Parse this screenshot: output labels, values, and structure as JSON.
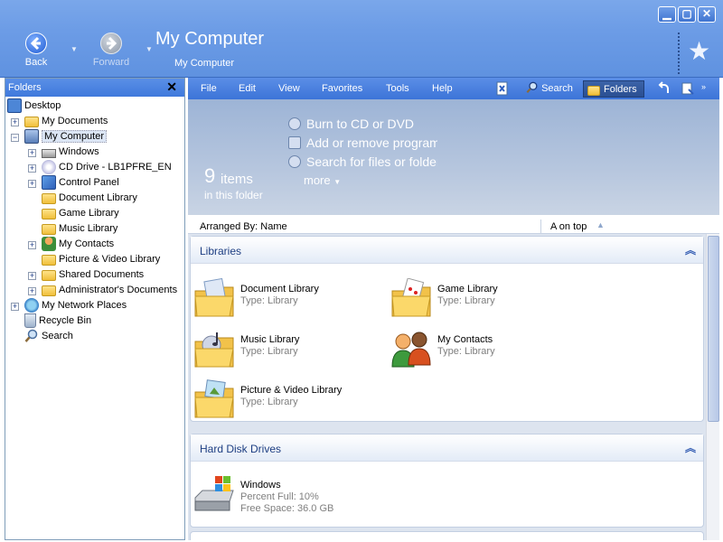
{
  "header": {
    "back_label": "Back",
    "forward_label": "Forward",
    "title": "My Computer",
    "address": "My Computer"
  },
  "folders_pane": {
    "title": "Folders",
    "items": [
      {
        "label": "Desktop",
        "icon": "desktop-icon"
      },
      {
        "label": "My Documents",
        "icon": "my-documents-icon"
      },
      {
        "label": "My Computer",
        "icon": "my-computer-icon",
        "selected": true
      },
      {
        "label": "Windows",
        "icon": "drive-icon"
      },
      {
        "label": "CD Drive - LB1PFRE_EN",
        "icon": "cd-drive-icon"
      },
      {
        "label": "Control Panel",
        "icon": "control-panel-icon"
      },
      {
        "label": "Document Library",
        "icon": "library-icon"
      },
      {
        "label": "Game Library",
        "icon": "library-icon"
      },
      {
        "label": "Music Library",
        "icon": "library-icon"
      },
      {
        "label": "My Contacts",
        "icon": "contacts-icon"
      },
      {
        "label": "Picture & Video Library",
        "icon": "library-icon"
      },
      {
        "label": "Shared Documents",
        "icon": "folder-icon"
      },
      {
        "label": "Administrator's Documents",
        "icon": "folder-icon"
      },
      {
        "label": "My Network Places",
        "icon": "network-icon"
      },
      {
        "label": "Recycle Bin",
        "icon": "recycle-bin-icon"
      },
      {
        "label": "Search",
        "icon": "search-icon"
      }
    ]
  },
  "menu": {
    "file": "File",
    "edit": "Edit",
    "view": "View",
    "favorites": "Favorites",
    "tools": "Tools",
    "help": "Help",
    "search": "Search",
    "folders": "Folders"
  },
  "taskband": {
    "count": "9",
    "count_word": "items",
    "count_sub": "in this folder",
    "tasks": [
      "Burn to CD or DVD",
      "Add or remove programs",
      "Search for files or folders"
    ],
    "more": "more"
  },
  "arranged": {
    "left": "Arranged By: Name",
    "right": "A on top"
  },
  "groups": {
    "libraries": {
      "title": "Libraries",
      "items": [
        {
          "name": "Document Library",
          "type": "Type: Library"
        },
        {
          "name": "Game Library",
          "type": "Type: Library"
        },
        {
          "name": "Music Library",
          "type": "Type: Library"
        },
        {
          "name": "My Contacts",
          "type": "Type: Library"
        },
        {
          "name": "Picture & Video Library",
          "type": "Type: Library"
        }
      ]
    },
    "hard_disks": {
      "title": "Hard Disk Drives",
      "items": [
        {
          "name": "Windows",
          "percent": "Percent Full: 10%",
          "free": "Free Space: 36.0 GB"
        }
      ]
    }
  },
  "colors": {
    "header_blue": "#6c9ce6",
    "menubar_blue": "#3c74d8",
    "group_title": "#1d3e82"
  }
}
